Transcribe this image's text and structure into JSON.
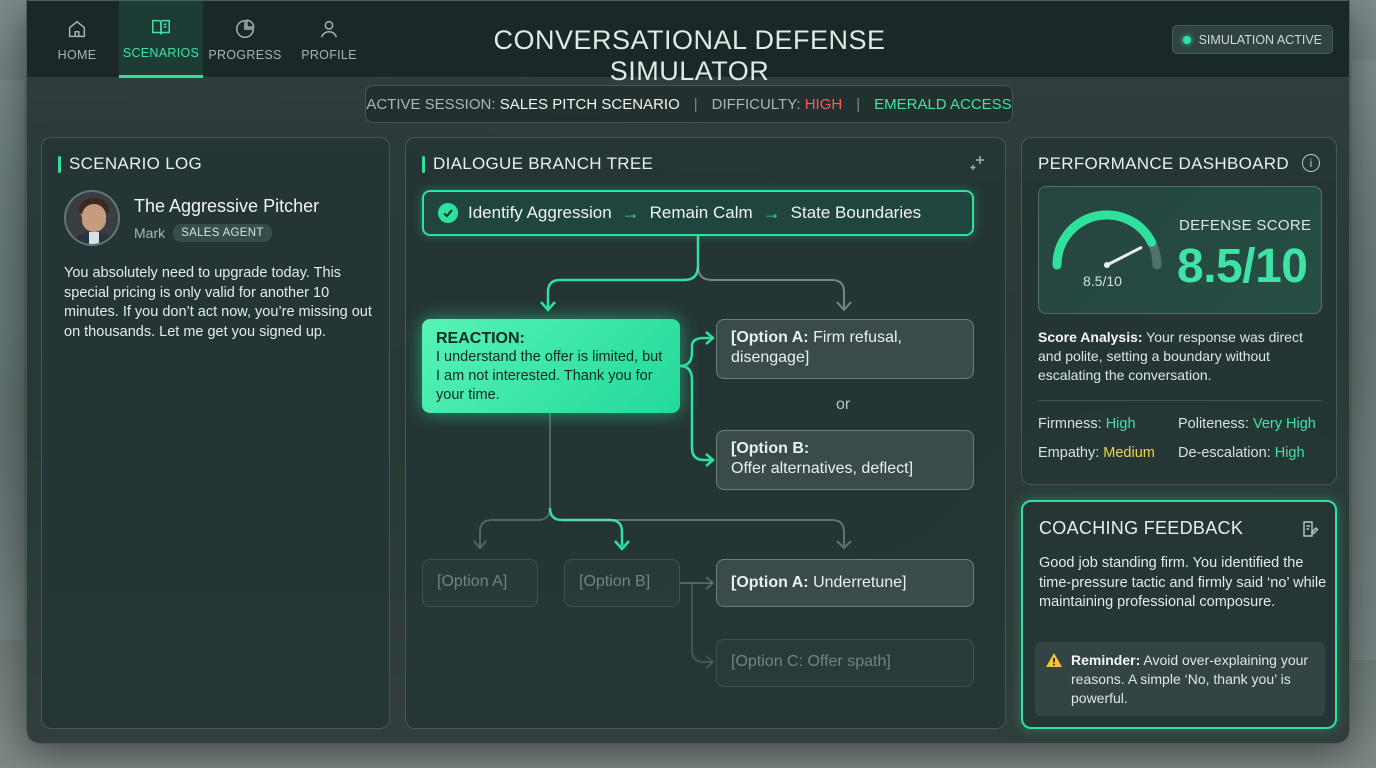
{
  "nav": {
    "items": [
      {
        "label": "HOME",
        "icon": "home-icon"
      },
      {
        "label": "SCENARIOS",
        "icon": "book-icon",
        "active": true
      },
      {
        "label": "PROGRESS",
        "icon": "pie-chart-icon"
      },
      {
        "label": "PROFILE",
        "icon": "user-icon"
      }
    ]
  },
  "header": {
    "title": "CONVERSATIONAL DEFENSE SIMULATOR",
    "status": "SIMULATION ACTIVE"
  },
  "session": {
    "active_label": "ACTIVE SESSION:",
    "active_value": "SALES PITCH SCENARIO",
    "difficulty_label": "DIFFICULTY:",
    "difficulty_value": "HIGH",
    "access": "EMERALD ACCESS"
  },
  "scenario_log": {
    "title": "SCENARIO LOG",
    "persona_name": "The Aggressive Pitcher",
    "persona_first": "Mark",
    "persona_role": "SALES AGENT",
    "quote": "You absolutely need to upgrade today. This special pricing is only valid for another 10 minutes. If you don’t act now, you’re missing out on thousands. Let me get you signed up."
  },
  "dialogue": {
    "title": "DIALOGUE BRANCH TREE",
    "path": [
      "Identify Aggression",
      "Remain Calm",
      "State Boundaries"
    ],
    "reaction_label": "REACTION:",
    "reaction_text": "I understand the offer is limited, but I am not interested. Thank you for your time.",
    "option_a_label": "[Option A:",
    "option_a_text": "Firm refusal, disengage]",
    "or": "or",
    "option_b_label": "[Option B:",
    "option_b_text": "Offer alternatives, deflect]",
    "dim_a": "[Option A]",
    "dim_b": "[Option B]",
    "option_a2_label": "[Option A:",
    "option_a2_text": "Underretune]",
    "option_c": "[Option C: Offer spath]"
  },
  "performance": {
    "title": "PERFORMANCE DASHBOARD",
    "gauge_label": "8.5/10",
    "gauge_fraction": 0.85,
    "score_label": "DEFENSE SCORE",
    "score_value": "8.5/10",
    "analysis_label": "Score Analysis:",
    "analysis_text": "Your response was direct and polite, setting a boundary without escalating the conversation.",
    "metrics": [
      {
        "name": "Firmness:",
        "value": "High"
      },
      {
        "name": "Politeness:",
        "value": "Very High"
      },
      {
        "name": "Empathy:",
        "value": "Medium"
      },
      {
        "name": "De-escalation:",
        "value": "High"
      }
    ]
  },
  "coaching": {
    "title": "COACHING FEEDBACK",
    "text": "Good job standing firm. You identified the time-pressure tactic and firmly said ‘no’ while maintaining professional composure.",
    "reminder_label": "Reminder:",
    "reminder_text": "Avoid over-explaining your reasons. A simple ‘No, thank you’ is powerful."
  },
  "colors": {
    "accent": "#2ee29e",
    "danger": "#ff5a5a",
    "warning": "#f2d24a"
  }
}
